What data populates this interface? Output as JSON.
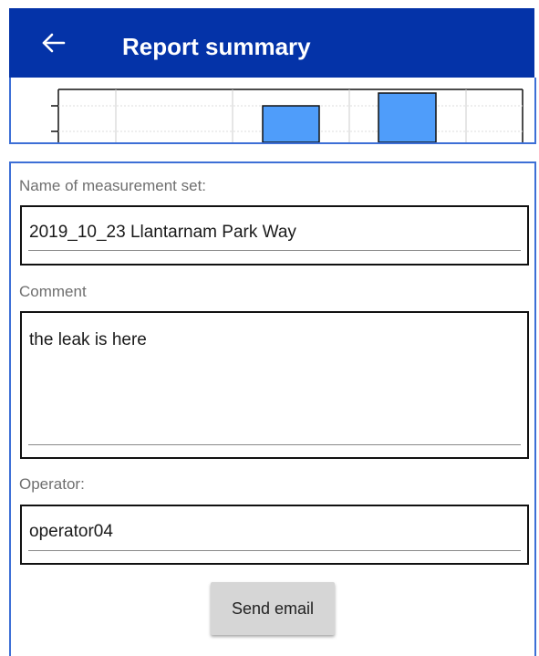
{
  "header": {
    "title": "Report summary",
    "back_icon": "arrow-left-icon",
    "background_color": "#0433a8"
  },
  "chart_data": {
    "type": "bar",
    "bar_color": "#4f9dfa",
    "grid": true
  },
  "form": {
    "name_label": "Name of measurement set:",
    "name_value": "2019_10_23 Llantarnam Park Way",
    "comment_label": "Comment",
    "comment_value": "the leak is here",
    "operator_label": "Operator:",
    "operator_value": "operator04",
    "send_button_label": "Send email"
  },
  "colors": {
    "accent_border": "#3d6fd6",
    "label_text": "#6f6f6f",
    "button_bg": "#d6d6d6"
  }
}
